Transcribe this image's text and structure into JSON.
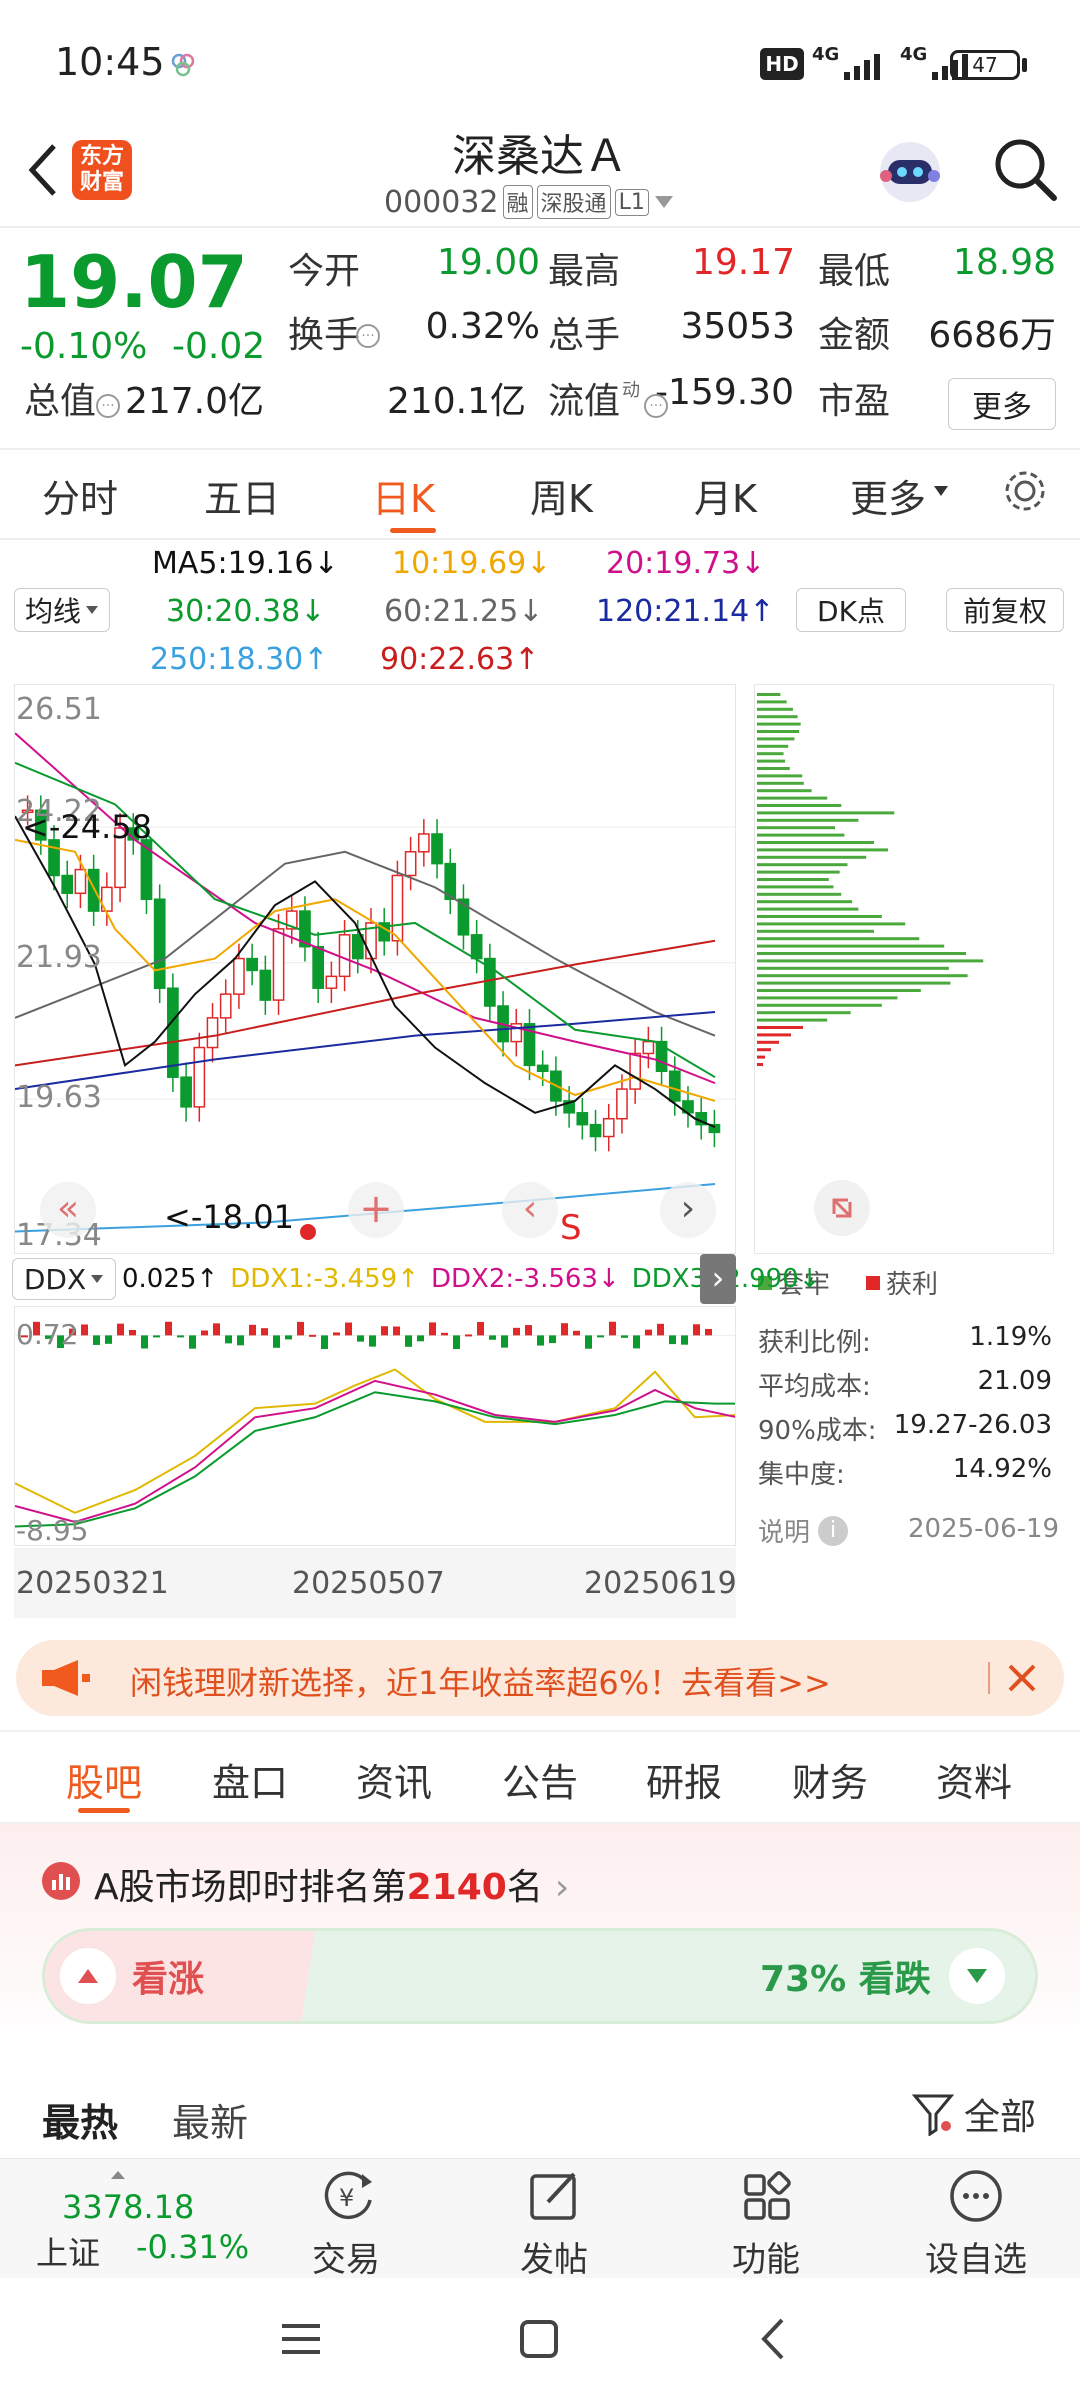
{
  "status": {
    "time": "10:45",
    "battery": "47",
    "signal1": "4G",
    "signal2": "4G",
    "hd": "HD"
  },
  "header": {
    "logo_top": "东方",
    "logo_bottom": "财富",
    "title": "深桑达Ａ",
    "code": "000032",
    "tags": [
      "融",
      "深股通",
      "L1"
    ]
  },
  "quote": {
    "price": "19.07",
    "pct": "-0.10%",
    "chg": "-0.02",
    "fields": [
      {
        "label": "今开",
        "value": "19.00",
        "tone": "green"
      },
      {
        "label": "最高",
        "value": "19.17",
        "tone": "red"
      },
      {
        "label": "最低",
        "value": "18.98",
        "tone": "green"
      },
      {
        "label": "换手",
        "value": "0.32%",
        "tone": "dark"
      },
      {
        "label": "总手",
        "value": "35053",
        "tone": "dark"
      },
      {
        "label": "金额",
        "value": "6686万",
        "tone": "dark"
      },
      {
        "label": "总值",
        "value": "217.0亿",
        "tone": "dark"
      },
      {
        "label": "流值",
        "value": "210.1亿",
        "tone": "dark"
      },
      {
        "label": "市盈",
        "value": "-159.30",
        "tone": "dark"
      }
    ],
    "pe_sup": "动",
    "more": "更多"
  },
  "chart_tabs": [
    "分时",
    "五日",
    "日K",
    "周K",
    "月K",
    "更多"
  ],
  "active_chart_tab": "日K",
  "ma": {
    "selector": "均线",
    "items": [
      {
        "text": "MA5:19.16↓",
        "color": "#111111"
      },
      {
        "text": "10:19.69↓",
        "color": "#f0a800"
      },
      {
        "text": "20:19.73↓",
        "color": "#d0108a"
      },
      {
        "text": "30:20.38↓",
        "color": "#0a9a2e"
      },
      {
        "text": "60:21.25↓",
        "color": "#666666"
      },
      {
        "text": "120:21.14↑",
        "color": "#1a2aa0"
      },
      {
        "text": "250:18.30↑",
        "color": "#3aa0e0"
      },
      {
        "text": "90:22.63↑",
        "color": "#c81e1e"
      }
    ],
    "dk_button": "DK点",
    "fq_button": "前复权"
  },
  "kline": {
    "y_labels": [
      "26.51",
      "24.22",
      "21.93",
      "19.63",
      "17.34"
    ],
    "high_mark": "<-24.58",
    "low_mark": "<-18.01",
    "signal": "S"
  },
  "chip": {
    "legend_hold": "套牢",
    "legend_profit": "获利",
    "stats": [
      {
        "label": "获利比例:",
        "value": "1.19%"
      },
      {
        "label": "平均成本:",
        "value": "21.09"
      },
      {
        "label": "90%成本:",
        "value": "19.27-26.03"
      },
      {
        "label": "集中度:",
        "value": "14.92%"
      }
    ],
    "note": "说明",
    "date": "2025-06-19"
  },
  "ddx": {
    "selector": "DDX",
    "value": "0.025↑",
    "items": [
      {
        "text": "DDX1:-3.459↑",
        "color": "#e0b800"
      },
      {
        "text": "DDX2:-3.563↓",
        "color": "#d0108a"
      },
      {
        "text": "DDX3:-2.990↓",
        "color": "#0a9a2e"
      }
    ],
    "y_top": "0.72",
    "y_bottom": "-8.95"
  },
  "dates": [
    "20250321",
    "20250507",
    "20250619"
  ],
  "chart_data": {
    "type": "line",
    "title": "",
    "x": [
      "20250321",
      "20250507",
      "20250619"
    ],
    "series": [
      {
        "name": "MA5",
        "values": [
          19.16
        ]
      },
      {
        "name": "MA10",
        "values": [
          19.69
        ]
      },
      {
        "name": "MA20",
        "values": [
          19.73
        ]
      },
      {
        "name": "MA30",
        "values": [
          20.38
        ]
      },
      {
        "name": "MA60",
        "values": [
          21.25
        ]
      },
      {
        "name": "MA120",
        "values": [
          21.14
        ]
      },
      {
        "name": "MA250",
        "values": [
          18.3
        ]
      },
      {
        "name": "MA90",
        "values": [
          22.63
        ]
      }
    ],
    "ylim": [
      17.34,
      26.51
    ],
    "y_ticks": [
      26.51,
      24.22,
      21.93,
      19.63,
      17.34
    ],
    "annotations": [
      "<-24.58",
      "<-18.01",
      "S"
    ],
    "ddx": {
      "values": {
        "DDX": 0.025,
        "DDX1": -3.459,
        "DDX2": -3.563,
        "DDX3": -2.99
      },
      "ylim": [
        -8.95,
        0.72
      ]
    }
  },
  "ad": {
    "text": "闲钱理财新选择，近1年收益率超6%！去看看>>"
  },
  "section_tabs": [
    "股吧",
    "盘口",
    "资讯",
    "公告",
    "研报",
    "财务",
    "资料"
  ],
  "active_section_tab": "股吧",
  "ranking": {
    "prefix": "A股市场即时排名第",
    "rank": "2140",
    "suffix": "名"
  },
  "vote": {
    "up_label": "看涨",
    "down_label": "73% 看跌",
    "down_percent": 73
  },
  "feed_tabs": {
    "hot": "最热",
    "new": "最新",
    "filter": "全部"
  },
  "bottom": {
    "index_value": "3378.18",
    "index_name": "上证",
    "index_pct": "-0.31%",
    "nav": [
      "交易",
      "发帖",
      "功能",
      "设自选"
    ]
  }
}
